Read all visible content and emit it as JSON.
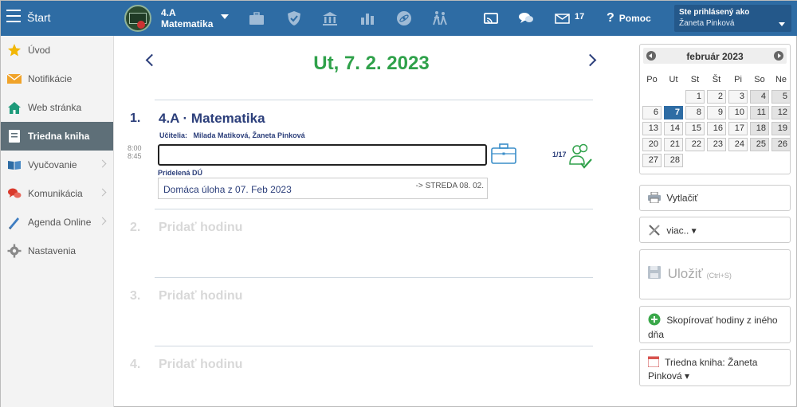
{
  "topbar": {
    "start_label": "Štart",
    "class_name": "4.A",
    "subject": "Matematika",
    "message_count": "17",
    "help_label": "Pomoc",
    "user_caption": "Ste prihlásený ako",
    "user_name": "Žaneta Pinková"
  },
  "sidebar": {
    "items": [
      {
        "label": "Úvod",
        "icon": "star-icon"
      },
      {
        "label": "Notifikácie",
        "icon": "envelope-icon"
      },
      {
        "label": "Web stránka",
        "icon": "home-icon"
      },
      {
        "label": "Triedna kniha",
        "icon": "book-icon"
      },
      {
        "label": "Vyučovanie",
        "icon": "open-book-icon"
      },
      {
        "label": "Komunikácia",
        "icon": "chat-icon"
      },
      {
        "label": "Agenda Online",
        "icon": "pen-icon"
      },
      {
        "label": "Nastavenia",
        "icon": "gear-icon"
      }
    ]
  },
  "main": {
    "date_title": "Ut, 7. 2. 2023",
    "lesson": {
      "number": "1.",
      "title": "4.A · Matematika",
      "teachers_label": "Učitelia:",
      "teachers": "Milada Matiková, Žaneta Pinková",
      "time_start": "8:00",
      "time_end": "8:45",
      "topic_value": "",
      "attendance": "1/17",
      "homework_label": "Pridelená DÚ",
      "homework_text": "Domáca úloha z 07. Feb 2023",
      "homework_due": "-> STREDA 08. 02."
    },
    "add_slots": [
      {
        "number": "2.",
        "label": "Pridať hodinu"
      },
      {
        "number": "3.",
        "label": "Pridať hodinu"
      },
      {
        "number": "4.",
        "label": "Pridať hodinu"
      }
    ]
  },
  "calendar": {
    "month": "február 2023",
    "weekdays": [
      "Po",
      "Ut",
      "St",
      "Št",
      "Pi",
      "So",
      "Ne"
    ],
    "selected_day": "7",
    "weeks": [
      [
        "",
        "",
        "1",
        "2",
        "3",
        "4",
        "5"
      ],
      [
        "6",
        "7",
        "8",
        "9",
        "10",
        "11",
        "12"
      ],
      [
        "13",
        "14",
        "15",
        "16",
        "17",
        "18",
        "19"
      ],
      [
        "20",
        "21",
        "22",
        "23",
        "24",
        "25",
        "26"
      ],
      [
        "27",
        "28",
        "",
        "",
        "",
        "",
        ""
      ]
    ]
  },
  "actions": {
    "print_label": "Vytlačiť",
    "more_label": "viac.. ▾",
    "save_label": "Uložiť",
    "save_shortcut": "(Ctrl+S)",
    "copy_label": "Skopírovať hodiny z iného dňa",
    "book_label": "Triedna kniha: Žaneta Pinková ▾"
  },
  "colors": {
    "topbar": "#2e6ca4",
    "date_green": "#2fa14a",
    "navy": "#2b3e7a",
    "sidebar_active": "#5e6f78"
  }
}
